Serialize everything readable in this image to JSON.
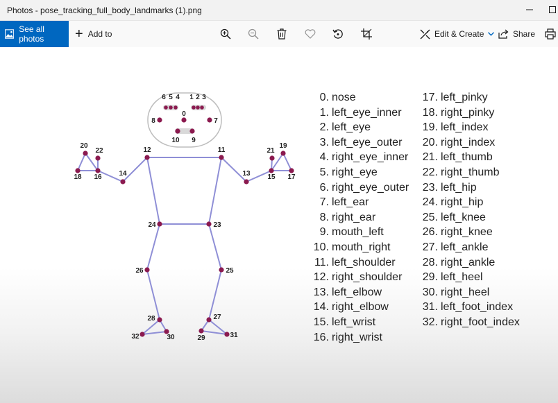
{
  "window": {
    "title": "Photos - pose_tracking_full_body_landmarks (1).png"
  },
  "toolbar": {
    "see_all_label": "See all photos",
    "add_to_label": "Add to",
    "edit_create_label": "Edit & Create",
    "share_label": "Share",
    "icons": [
      "zoom-in-icon",
      "zoom-out-icon",
      "delete-icon",
      "favorite-icon",
      "rotate-icon",
      "crop-icon",
      "print-icon"
    ]
  },
  "image": {
    "skeleton_labels": [
      "0",
      "1",
      "2",
      "3",
      "4",
      "5",
      "6",
      "7",
      "8",
      "9",
      "10",
      "11",
      "12",
      "13",
      "14",
      "15",
      "16",
      "17",
      "18",
      "19",
      "20",
      "21",
      "22",
      "23",
      "24",
      "25",
      "26",
      "27",
      "28",
      "29",
      "30",
      "31",
      "32"
    ],
    "landmarks_col1": [
      {
        "num": "0.",
        "name": "nose"
      },
      {
        "num": "1.",
        "name": "left_eye_inner"
      },
      {
        "num": "2.",
        "name": "left_eye"
      },
      {
        "num": "3.",
        "name": "left_eye_outer"
      },
      {
        "num": "4.",
        "name": "right_eye_inner"
      },
      {
        "num": "5.",
        "name": "right_eye"
      },
      {
        "num": "6.",
        "name": "right_eye_outer"
      },
      {
        "num": "7.",
        "name": "left_ear"
      },
      {
        "num": "8.",
        "name": "right_ear"
      },
      {
        "num": "9.",
        "name": "mouth_left"
      },
      {
        "num": "10.",
        "name": "mouth_right"
      },
      {
        "num": "11.",
        "name": "left_shoulder"
      },
      {
        "num": "12.",
        "name": "right_shoulder"
      },
      {
        "num": "13.",
        "name": "left_elbow"
      },
      {
        "num": "14.",
        "name": "right_elbow"
      },
      {
        "num": "15.",
        "name": "left_wrist"
      },
      {
        "num": "16.",
        "name": "right_wrist"
      }
    ],
    "landmarks_col2": [
      {
        "num": "17.",
        "name": "left_pinky"
      },
      {
        "num": "18.",
        "name": "right_pinky"
      },
      {
        "num": "19.",
        "name": "left_index"
      },
      {
        "num": "20.",
        "name": "right_index"
      },
      {
        "num": "21.",
        "name": "left_thumb"
      },
      {
        "num": "22.",
        "name": "right_thumb"
      },
      {
        "num": "23.",
        "name": "left_hip"
      },
      {
        "num": "24.",
        "name": "right_hip"
      },
      {
        "num": "25.",
        "name": "left_knee"
      },
      {
        "num": "26.",
        "name": "right_knee"
      },
      {
        "num": "27.",
        "name": "left_ankle"
      },
      {
        "num": "28.",
        "name": "right_ankle"
      },
      {
        "num": "29.",
        "name": "left_heel"
      },
      {
        "num": "30.",
        "name": "right_heel"
      },
      {
        "num": "31.",
        "name": "left_foot_index"
      },
      {
        "num": "32.",
        "name": "right_foot_index"
      }
    ]
  },
  "colors": {
    "accent": "#0067c0",
    "joint": "#8b1a4f",
    "bone": "#8f8fd6"
  }
}
